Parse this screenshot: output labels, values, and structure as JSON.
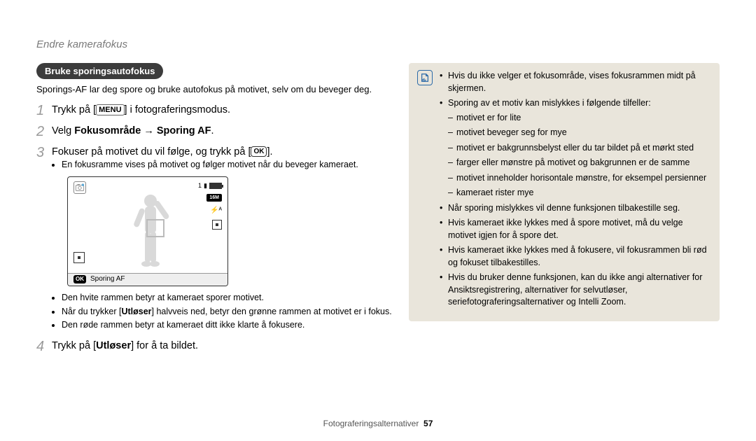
{
  "breadcrumb": "Endre kamerafokus",
  "pill_heading": "Bruke sporingsautofokus",
  "intro": "Sporings-AF lar deg spore og bruke autofokus på motivet, selv om du beveger deg.",
  "buttons": {
    "menu": "MENU",
    "ok": "OK",
    "ok_small": "OK"
  },
  "steps": {
    "s1_a": "Trykk på [",
    "s1_b": "] i fotograferingsmodus.",
    "s2_a": "Velg ",
    "s2_bold": "Fokusområde → Sporing AF",
    "s2_b": ".",
    "s3_a": "Fokuser på motivet du vil følge, og trykk på [",
    "s3_b": "].",
    "s3_bullet1": "En fokusramme vises på motivet og følger motivet når du beveger kameraet.",
    "s3_bullet2": "Den hvite rammen betyr at kameraet sporer motivet.",
    "s3_bullet3_a": "Når du trykker [",
    "s3_bullet3_bold": "Utløser",
    "s3_bullet3_b": "] halvveis ned, betyr den grønne rammen at motivet er i fokus.",
    "s3_bullet4": "Den røde rammen betyr at kameraet ditt ikke klarte å fokusere.",
    "s4_a": "Trykk på [",
    "s4_bold": "Utløser",
    "s4_b": "] for å ta bildet."
  },
  "lcd": {
    "size_label": "16M",
    "flash_label": "ƒᴬ",
    "batt_count": "1",
    "bottom_label": "Sporing AF"
  },
  "info": {
    "b1": "Hvis du ikke velger et fokusområde, vises fokusrammen midt på skjermen.",
    "b2": "Sporing av et motiv kan mislykkes i følgende tilfeller:",
    "b2_d1": "motivet er for lite",
    "b2_d2": "motivet beveger seg for mye",
    "b2_d3": "motivet er bakgrunnsbelyst eller du tar bildet på et mørkt sted",
    "b2_d4": "farger eller mønstre på motivet og bakgrunnen er de samme",
    "b2_d5": "motivet inneholder horisontale mønstre, for eksempel persienner",
    "b2_d6": "kameraet rister mye",
    "b3": "Når sporing mislykkes vil denne funksjonen tilbakestille seg.",
    "b4": "Hvis kameraet ikke lykkes med å spore motivet, må du velge motivet igjen for å spore det.",
    "b5": "Hvis kameraet ikke lykkes med å fokusere, vil fokusrammen bli rød og fokuset tilbakestilles.",
    "b6": "Hvis du bruker denne funksjonen, kan du ikke angi alternativer for Ansiktsregistrering, alternativer for selvutløser, seriefotograferingsalternativer og Intelli Zoom."
  },
  "footer": {
    "section": "Fotograferingsalternativer",
    "page": "57"
  }
}
